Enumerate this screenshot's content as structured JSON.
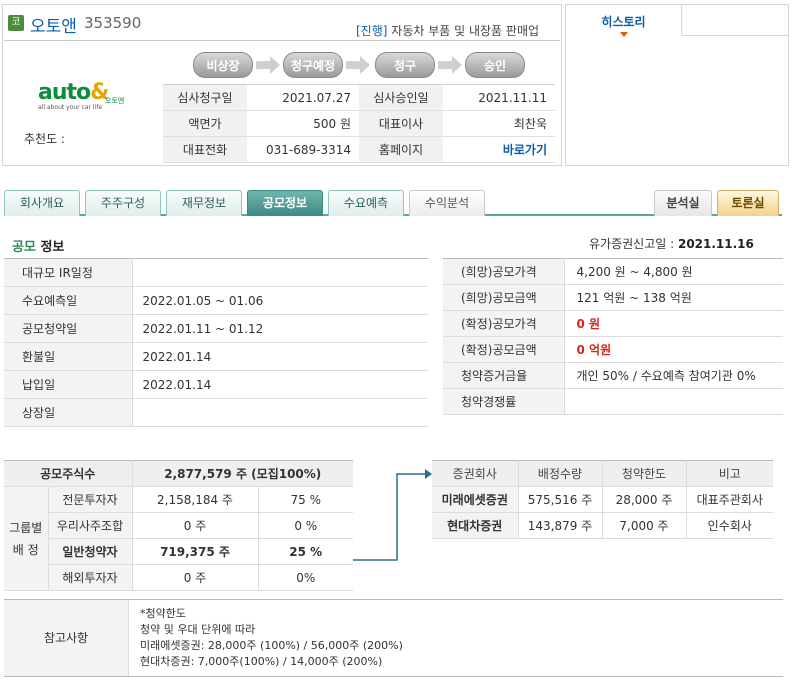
{
  "company": {
    "badge": "코",
    "name": "오토앤",
    "code": "353590",
    "status_prefix": "[진행]",
    "status_text": "자동차 부품 및 내장품 판매업",
    "logo_text_a": "auto",
    "logo_text_b": "&",
    "logo_sub": "all about your car life",
    "logo_ko": "오토앤",
    "recommend_label": "추천도 :"
  },
  "steps": [
    "비상장",
    "청구예정",
    "청구",
    "승인"
  ],
  "history_tab": "히스토리",
  "info": {
    "r1": {
      "k1": "심사청구일",
      "v1": "2021.07.27",
      "k2": "심사승인일",
      "v2": "2021.11.11"
    },
    "r2": {
      "k1": "액면가",
      "v1": "500 원",
      "k2": "대표이사",
      "v2": "최찬욱"
    },
    "r3": {
      "k1": "대표전화",
      "v1": "031-689-3314",
      "k2": "홈페이지",
      "v2": "바로가기"
    }
  },
  "tabs": [
    "회사개요",
    "주주구성",
    "재무정보",
    "공모정보",
    "수요예측",
    "수익분석",
    "분석실",
    "토론실"
  ],
  "section": {
    "title_a": "공모",
    "title_b": "정보",
    "file_label": "유가증권신고일 :",
    "file_date": "2021.11.16"
  },
  "schedule": [
    {
      "k": "대규모 IR일정",
      "v": ""
    },
    {
      "k": "수요예측일",
      "v": "2022.01.05 ~ 01.06"
    },
    {
      "k": "공모청약일",
      "v": "2022.01.11 ~ 01.12"
    },
    {
      "k": "환불일",
      "v": "2022.01.14"
    },
    {
      "k": "납입일",
      "v": "2022.01.14"
    },
    {
      "k": "상장일",
      "v": ""
    }
  ],
  "price": [
    {
      "k": "(희망)공모가격",
      "v": "4,200 원 ~ 4,800 원"
    },
    {
      "k": "(희망)공모금액",
      "v": "121 억원   ~ 138 억원"
    },
    {
      "k": "(확정)공모가격",
      "v": "0 원"
    },
    {
      "k": "(확정)공모금액",
      "v": "0 억원"
    },
    {
      "k": "청약증거금율",
      "v": "개인 50% / 수요예측 참여기관 0%"
    },
    {
      "k": "청약경쟁률",
      "v": ""
    }
  ],
  "shares": {
    "head_k": "공모주식수",
    "head_v": "2,877,579 주 (모집100%)",
    "group_label_a": "그룹별",
    "group_label_b": "배 정",
    "rows": [
      {
        "k": "전문투자자",
        "v": "2,158,184 주",
        "p": "75 %"
      },
      {
        "k": "우리사주조합",
        "v": "0 주",
        "p": "0 %"
      },
      {
        "k": "일반청약자",
        "v": "719,375 주",
        "p": "25 %"
      },
      {
        "k": "해외투자자",
        "v": "0 주",
        "p": "0%"
      }
    ]
  },
  "brokers": {
    "headers": [
      "증권회사",
      "배정수량",
      "청약한도",
      "비고"
    ],
    "rows": [
      {
        "name": "미래에셋증권",
        "qty": "575,516 주",
        "limit": "28,000 주",
        "note": "대표주관회사"
      },
      {
        "name": "현대차증권",
        "qty": "143,879 주",
        "limit": "7,000 주",
        "note": "인수회사"
      }
    ]
  },
  "note": {
    "label": "참고사항",
    "l1": "*청약한도",
    "l2": "청약 및 우대 단위에 따라",
    "l3": "미래에셋증권: 28,000주 (100%) / 56,000주 (200%)",
    "l4": "현대차증권: 7,000주(100%) / 14,000주 (200%)"
  }
}
